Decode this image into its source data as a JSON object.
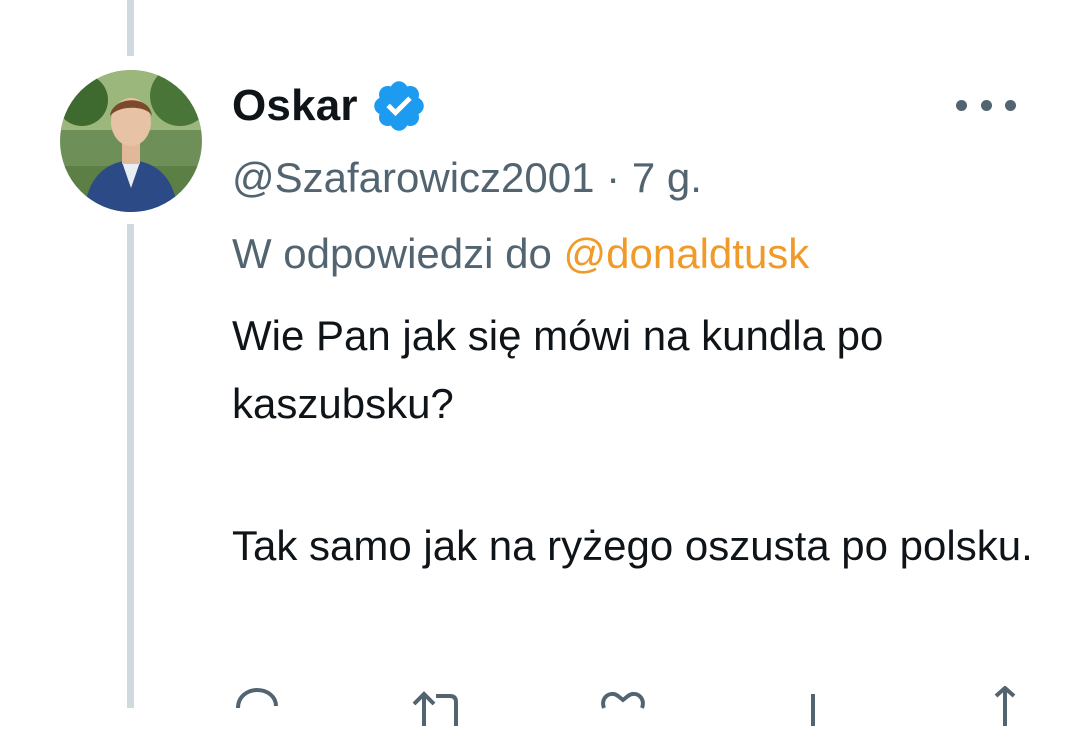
{
  "tweet": {
    "display_name": "Oskar",
    "handle": "@Szafarowicz2001",
    "separator": " · ",
    "time": "7 g.",
    "reply_prefix": "W odpowiedzi do ",
    "reply_mention": "@donaldtusk",
    "text_lines": [
      "Wie Pan jak się mówi na kundla po kaszubsku?",
      "Tak samo jak na ryżego oszusta po polsku."
    ],
    "verified": true
  },
  "icons": {
    "verified": "verified-badge-icon",
    "more": "more-horizontal-icon",
    "reply": "reply-icon",
    "retweet": "retweet-icon",
    "like": "heart-icon",
    "views": "views-icon",
    "share": "share-icon"
  },
  "colors": {
    "text": "#0f1419",
    "secondary": "#536471",
    "mention": "#f09a2a",
    "verified": "#1d9bf0",
    "thread_line": "#cfd9de"
  }
}
